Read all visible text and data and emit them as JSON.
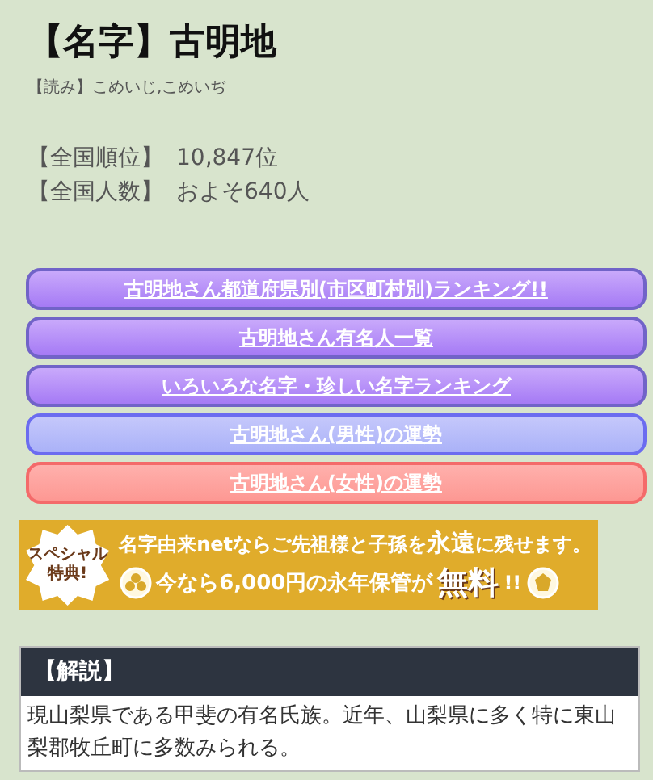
{
  "title": "【名字】古明地",
  "reading": "【読み】こめいじ,こめいぢ",
  "stats": [
    {
      "label": "【全国順位】",
      "value": "10,847位"
    },
    {
      "label": "【全国人数】",
      "value": "およそ640人"
    }
  ],
  "links": [
    {
      "label": "古明地さん都道府県別(市区町村別)ランキング!!",
      "kind": "purple"
    },
    {
      "label": "古明地さん有名人一覧",
      "kind": "purple"
    },
    {
      "label": "いろいろな名字・珍しい名字ランキング",
      "kind": "purple"
    },
    {
      "label": "古明地さん(男性)の運勢",
      "kind": "blue"
    },
    {
      "label": "古明地さん(女性)の運勢",
      "kind": "pink"
    }
  ],
  "banner": {
    "badge": [
      "スペシャル",
      "特典!"
    ],
    "line1": "名字由来netならご先祖様と子孫を**永遠**に残せます。",
    "line2": "今なら6,000円の永年保管が",
    "free": "無料",
    "exclaim": "!!"
  },
  "explanation": {
    "heading": "【解説】",
    "text": "現山梨県である甲斐の有名氏族。近年、山梨県に多く特に東山梨郡牧丘町に多数みられる。"
  }
}
